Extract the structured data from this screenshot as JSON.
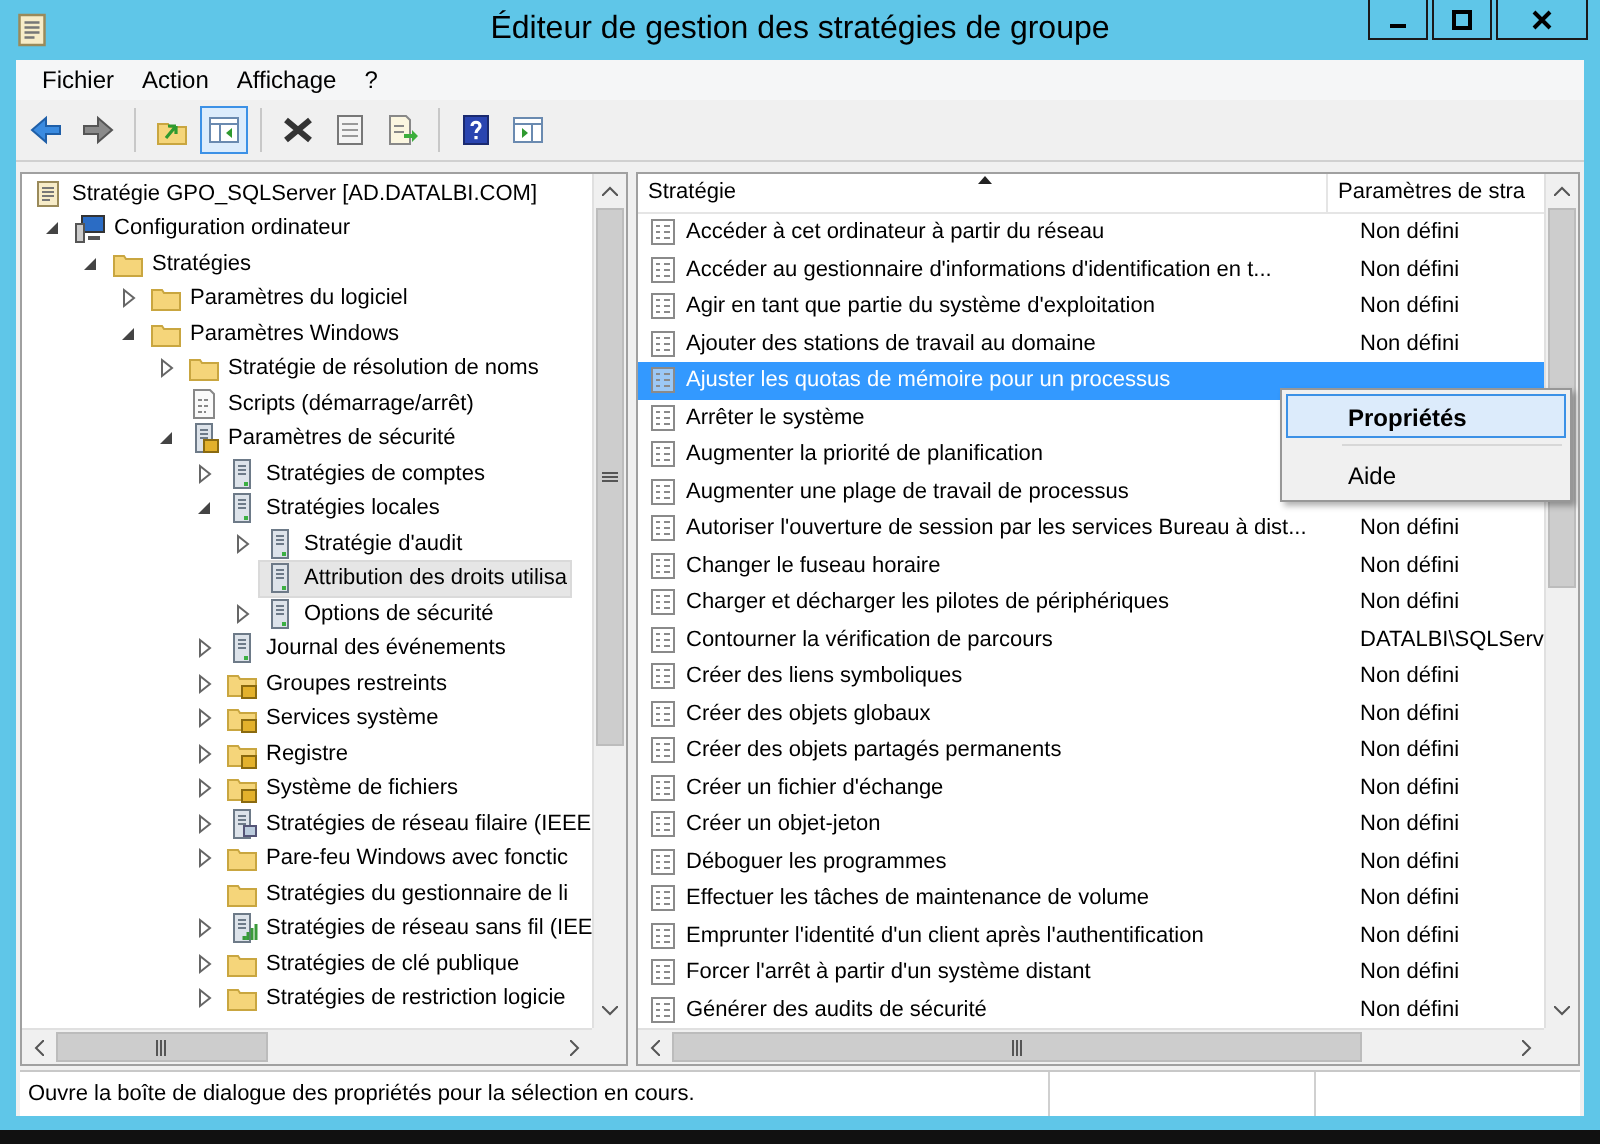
{
  "window": {
    "title": "Éditeur de gestion des stratégies de groupe"
  },
  "menu": [
    "Fichier",
    "Action",
    "Affichage",
    "?"
  ],
  "toolbar": [
    {
      "kind": "back",
      "pressed": false
    },
    {
      "kind": "forward",
      "pressed": false
    },
    {
      "kind": "sep"
    },
    {
      "kind": "up",
      "pressed": false
    },
    {
      "kind": "tree",
      "pressed": true
    },
    {
      "kind": "sep"
    },
    {
      "kind": "delete",
      "pressed": false
    },
    {
      "kind": "properties",
      "pressed": false
    },
    {
      "kind": "export",
      "pressed": false
    },
    {
      "kind": "sep"
    },
    {
      "kind": "help",
      "pressed": false
    },
    {
      "kind": "actionpane",
      "pressed": false
    }
  ],
  "tree": [
    {
      "label": "Stratégie GPO_SQLServer [AD.DATALBI.COM]",
      "kind": "scroll",
      "selected": false,
      "children": [
        {
          "label": "Configuration ordinateur",
          "kind": "computer",
          "expanded": true,
          "selected": false,
          "children": [
            {
              "label": "Stratégies",
              "kind": "folder",
              "expanded": true,
              "selected": false,
              "children": [
                {
                  "label": "Paramètres du logiciel",
                  "kind": "folder",
                  "expanded": false,
                  "selected": false
                },
                {
                  "label": "Paramètres Windows",
                  "kind": "folder",
                  "expanded": true,
                  "selected": false,
                  "children": [
                    {
                      "label": "Stratégie de résolution de noms",
                      "kind": "folder",
                      "expanded": false,
                      "selected": false
                    },
                    {
                      "label": "Scripts (démarrage/arrêt)",
                      "kind": "script",
                      "selected": false
                    },
                    {
                      "label": "Paramètres de sécurité",
                      "kind": "security",
                      "expanded": true,
                      "selected": false,
                      "children": [
                        {
                          "label": "Stratégies de comptes",
                          "kind": "server",
                          "expanded": false,
                          "selected": false
                        },
                        {
                          "label": "Stratégies locales",
                          "kind": "server",
                          "expanded": true,
                          "selected": false,
                          "children": [
                            {
                              "label": "Stratégie d'audit",
                              "kind": "server",
                              "expanded": false,
                              "selected": false
                            },
                            {
                              "label": "Attribution des droits utilisa",
                              "kind": "server",
                              "selected": true
                            },
                            {
                              "label": "Options de sécurité",
                              "kind": "server",
                              "expanded": false,
                              "selected": false
                            }
                          ]
                        },
                        {
                          "label": "Journal des événements",
                          "kind": "server",
                          "expanded": false,
                          "selected": false
                        },
                        {
                          "label": "Groupes restreints",
                          "kind": "lockfolder",
                          "expanded": false,
                          "selected": false
                        },
                        {
                          "label": "Services système",
                          "kind": "lockfolder",
                          "expanded": false,
                          "selected": false
                        },
                        {
                          "label": "Registre",
                          "kind": "lockfolder",
                          "expanded": false,
                          "selected": false
                        },
                        {
                          "label": "Système de fichiers",
                          "kind": "lockfolder",
                          "expanded": false,
                          "selected": false
                        },
                        {
                          "label": "Stratégies de réseau filaire (IEEE",
                          "kind": "network",
                          "expanded": false,
                          "selected": false
                        },
                        {
                          "label": "Pare-feu Windows avec fonctic",
                          "kind": "folder",
                          "expanded": false,
                          "selected": false
                        },
                        {
                          "label": "Stratégies du gestionnaire de li",
                          "kind": "folder",
                          "selected": false
                        },
                        {
                          "label": "Stratégies de réseau sans fil (IEE",
                          "kind": "wireless",
                          "expanded": false,
                          "selected": false
                        },
                        {
                          "label": "Stratégies de clé publique",
                          "kind": "folder",
                          "expanded": false,
                          "selected": false
                        },
                        {
                          "label": "Stratégies de restriction logicie",
                          "kind": "folder",
                          "expanded": false,
                          "selected": false
                        }
                      ]
                    }
                  ]
                }
              ]
            }
          ]
        }
      ]
    }
  ],
  "table": {
    "columns": [
      "Stratégie",
      "Paramètres de stra"
    ],
    "rows": [
      {
        "policy": "Accéder à cet ordinateur à partir du réseau",
        "setting": "Non défini",
        "selected": false
      },
      {
        "policy": "Accéder au gestionnaire d'informations d'identification en t...",
        "setting": "Non défini",
        "selected": false
      },
      {
        "policy": "Agir en tant que partie du système d'exploitation",
        "setting": "Non défini",
        "selected": false
      },
      {
        "policy": "Ajouter des stations de travail au domaine",
        "setting": "Non défini",
        "selected": false
      },
      {
        "policy": "Ajuster les quotas de mémoire pour un processus",
        "selected": true
      },
      {
        "policy": "Arrêter le système",
        "selected": false
      },
      {
        "policy": "Augmenter la priorité de planification",
        "selected": false
      },
      {
        "policy": "Augmenter une plage de travail de processus",
        "selected": false
      },
      {
        "policy": "Autoriser l'ouverture de session par les services Bureau à dist...",
        "setting": "Non défini",
        "selected": false
      },
      {
        "policy": "Changer le fuseau horaire",
        "setting": "Non défini",
        "selected": false
      },
      {
        "policy": "Charger et décharger les pilotes de périphériques",
        "setting": "Non défini",
        "selected": false
      },
      {
        "policy": "Contourner la vérification de parcours",
        "setting": "DATALBI\\SQLServ",
        "selected": false
      },
      {
        "policy": "Créer des liens symboliques",
        "setting": "Non défini",
        "selected": false
      },
      {
        "policy": "Créer des objets globaux",
        "setting": "Non défini",
        "selected": false
      },
      {
        "policy": "Créer des objets partagés permanents",
        "setting": "Non défini",
        "selected": false
      },
      {
        "policy": "Créer un fichier d'échange",
        "setting": "Non défini",
        "selected": false
      },
      {
        "policy": "Créer un objet-jeton",
        "setting": "Non défini",
        "selected": false
      },
      {
        "policy": "Déboguer les programmes",
        "setting": "Non défini",
        "selected": false
      },
      {
        "policy": "Effectuer les tâches de maintenance de volume",
        "setting": "Non défini",
        "selected": false
      },
      {
        "policy": "Emprunter l'identité d'un client après l'authentification",
        "setting": "Non défini",
        "selected": false
      },
      {
        "policy": "Forcer l'arrêt à partir d'un système distant",
        "setting": "Non défini",
        "selected": false
      },
      {
        "policy": "Générer des audits de sécurité",
        "setting": "Non défini",
        "selected": false
      }
    ]
  },
  "context_menu": [
    {
      "label": "Propriétés",
      "selected": true,
      "default": true
    },
    {
      "label": "Aide",
      "selected": false,
      "default": false
    }
  ],
  "status_bar": {
    "text": "Ouvre la boîte de dialogue des propriétés pour la sélection en cours."
  }
}
